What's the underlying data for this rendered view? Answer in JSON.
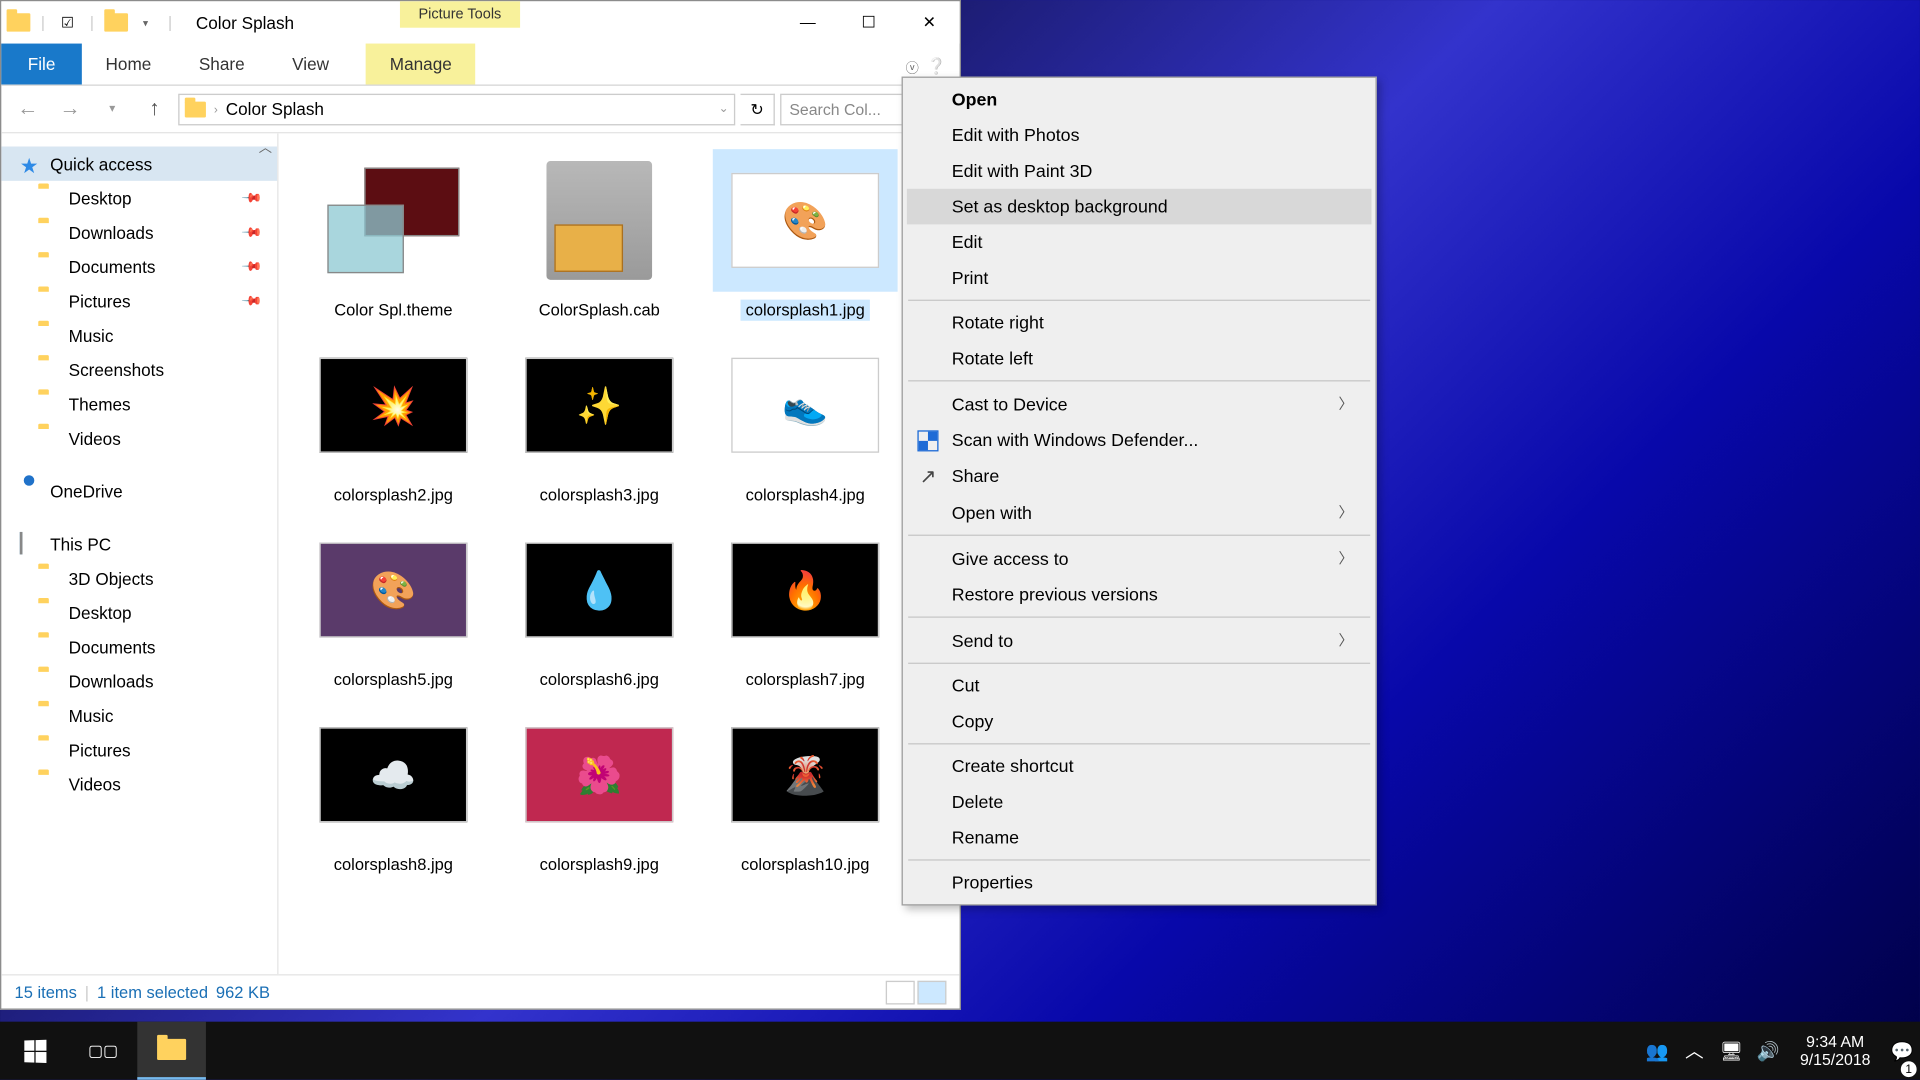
{
  "title": "Color Splash",
  "contextual_tab": "Picture Tools",
  "ribbon": {
    "file": "File",
    "home": "Home",
    "share": "Share",
    "view": "View",
    "manage": "Manage"
  },
  "nav": {
    "root_icon": "folder",
    "path": "Color Splash",
    "refresh": "↻",
    "search_placeholder": "Search Col..."
  },
  "sidebar": {
    "quick_access": "Quick access",
    "pinned": [
      {
        "label": "Desktop",
        "pinned": true
      },
      {
        "label": "Downloads",
        "pinned": true
      },
      {
        "label": "Documents",
        "pinned": true
      },
      {
        "label": "Pictures",
        "pinned": true
      }
    ],
    "recent": [
      {
        "label": "Music"
      },
      {
        "label": "Screenshots"
      },
      {
        "label": "Themes"
      },
      {
        "label": "Videos"
      }
    ],
    "onedrive": "OneDrive",
    "thispc": "This PC",
    "pc_items": [
      {
        "label": "3D Objects"
      },
      {
        "label": "Desktop"
      },
      {
        "label": "Documents"
      },
      {
        "label": "Downloads"
      },
      {
        "label": "Music"
      },
      {
        "label": "Pictures"
      },
      {
        "label": "Videos"
      }
    ]
  },
  "files": [
    {
      "name": "Color Spl.theme",
      "kind": "theme"
    },
    {
      "name": "ColorSplash.cab",
      "kind": "cab"
    },
    {
      "name": "colorsplash1.jpg",
      "kind": "img",
      "preview": "🎨",
      "bg": "#fff",
      "selected": true
    },
    {
      "name": "colorsplash2.jpg",
      "kind": "img",
      "preview": "💥",
      "bg": "#000"
    },
    {
      "name": "colorsplash3.jpg",
      "kind": "img",
      "preview": "✨",
      "bg": "#000"
    },
    {
      "name": "colorsplash4.jpg",
      "kind": "img",
      "preview": "👟",
      "bg": "#fff"
    },
    {
      "name": "colorsplash5.jpg",
      "kind": "img",
      "preview": "🎨",
      "bg": "#5a3a6a"
    },
    {
      "name": "colorsplash6.jpg",
      "kind": "img",
      "preview": "💧",
      "bg": "#000"
    },
    {
      "name": "colorsplash7.jpg",
      "kind": "img",
      "preview": "🔥",
      "bg": "#000"
    },
    {
      "name": "colorsplash8.jpg",
      "kind": "img",
      "preview": "☁️",
      "bg": "#000"
    },
    {
      "name": "colorsplash9.jpg",
      "kind": "img",
      "preview": "🌺",
      "bg": "#c02850"
    },
    {
      "name": "colorsplash10.jpg",
      "kind": "img",
      "preview": "🌋",
      "bg": "#000"
    }
  ],
  "status": {
    "count": "15 items",
    "selection": "1 item selected",
    "size": "962 KB"
  },
  "context_menu": [
    {
      "label": "Open",
      "bold": true
    },
    {
      "label": "Edit with Photos"
    },
    {
      "label": "Edit with Paint 3D"
    },
    {
      "label": "Set as desktop background",
      "hover": true
    },
    {
      "label": "Edit"
    },
    {
      "label": "Print"
    },
    {
      "sep": true
    },
    {
      "label": "Rotate right"
    },
    {
      "label": "Rotate left"
    },
    {
      "sep": true
    },
    {
      "label": "Cast to Device",
      "arrow": true
    },
    {
      "label": "Scan with Windows Defender...",
      "icon": "shield"
    },
    {
      "label": "Share",
      "icon": "share"
    },
    {
      "label": "Open with",
      "arrow": true
    },
    {
      "sep": true
    },
    {
      "label": "Give access to",
      "arrow": true
    },
    {
      "label": "Restore previous versions"
    },
    {
      "sep": true
    },
    {
      "label": "Send to",
      "arrow": true
    },
    {
      "sep": true
    },
    {
      "label": "Cut"
    },
    {
      "label": "Copy"
    },
    {
      "sep": true
    },
    {
      "label": "Create shortcut"
    },
    {
      "label": "Delete"
    },
    {
      "label": "Rename"
    },
    {
      "sep": true
    },
    {
      "label": "Properties"
    }
  ],
  "taskbar": {
    "time": "9:34 AM",
    "date": "9/15/2018",
    "notif_count": "1"
  }
}
